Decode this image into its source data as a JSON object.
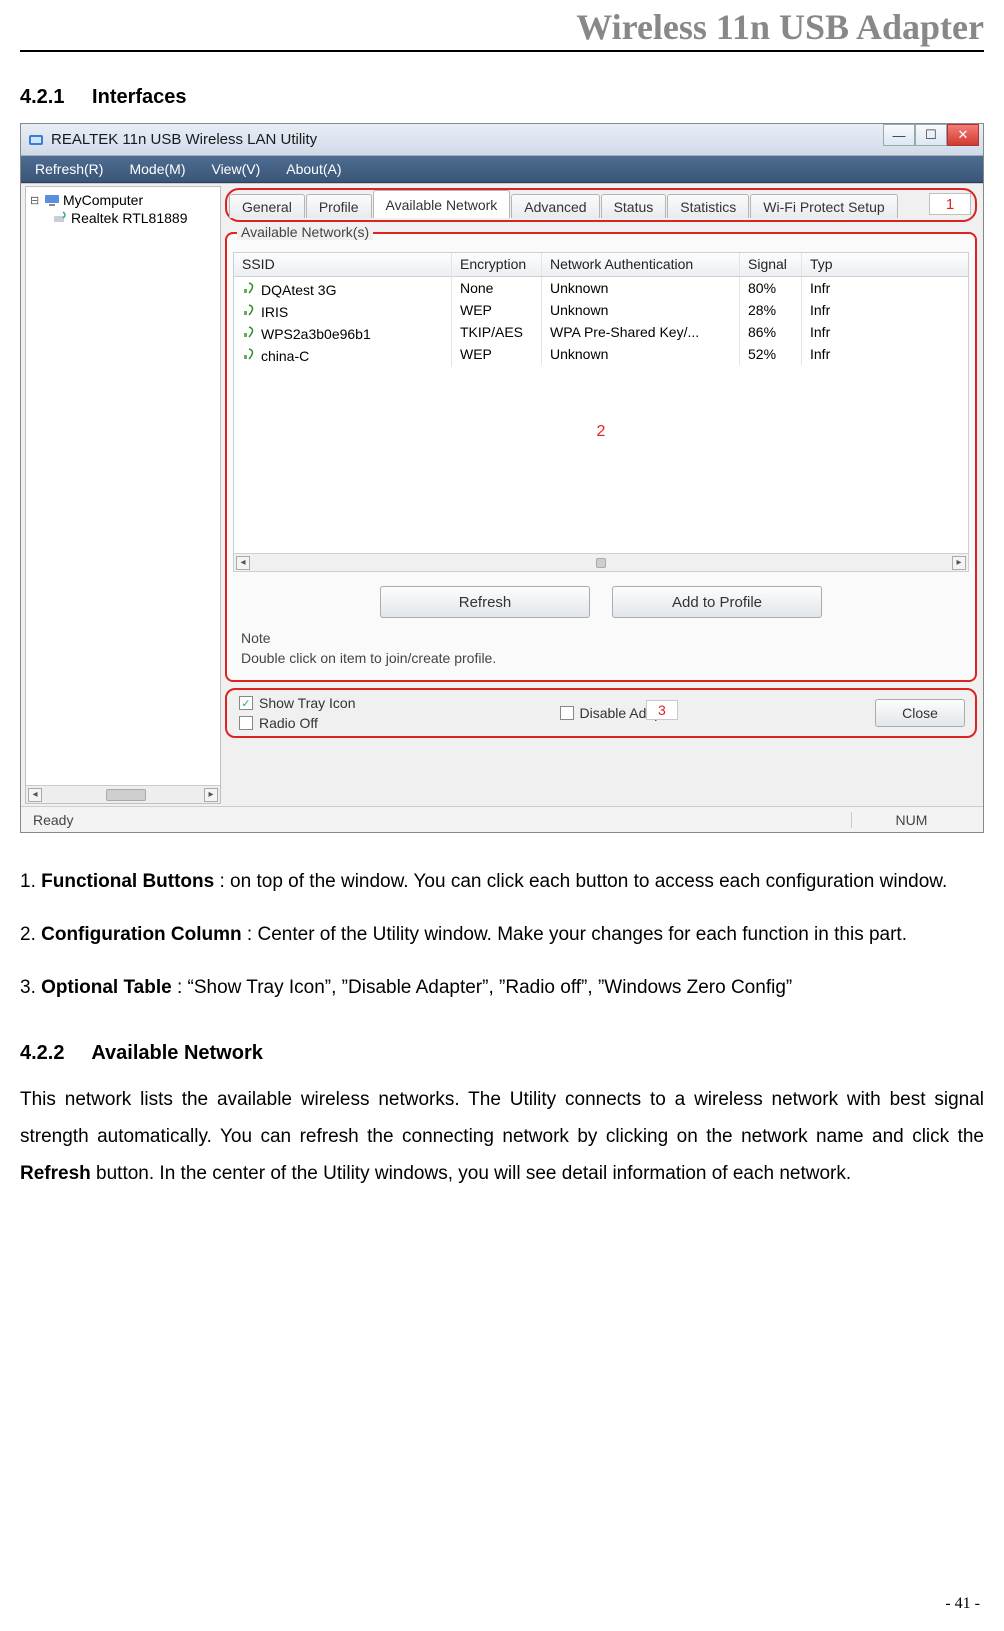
{
  "header": {
    "doc_title": "Wireless 11n USB Adapter"
  },
  "section421": {
    "number": "4.2.1",
    "title": "Interfaces"
  },
  "screenshot": {
    "titlebar": "REALTEK 11n USB Wireless LAN Utility",
    "menubar": [
      "Refresh(R)",
      "Mode(M)",
      "View(V)",
      "About(A)"
    ],
    "tree": {
      "root": "MyComputer",
      "child": "Realtek RTL81889"
    },
    "tabs": [
      "General",
      "Profile",
      "Available Network",
      "Advanced",
      "Status",
      "Statistics",
      "Wi-Fi Protect Setup"
    ],
    "active_tab_index": 2,
    "annotation_1": "1",
    "group_label": "Available Network(s)",
    "columns": [
      "SSID",
      "Encryption",
      "Network Authentication",
      "Signal",
      "Typ"
    ],
    "rows": [
      {
        "ssid": "DQAtest 3G",
        "enc": "None",
        "auth": "Unknown",
        "sig": "80%",
        "typ": "Infr"
      },
      {
        "ssid": "IRIS",
        "enc": "WEP",
        "auth": "Unknown",
        "sig": "28%",
        "typ": "Infr"
      },
      {
        "ssid": "WPS2a3b0e96b1",
        "enc": "TKIP/AES",
        "auth": "WPA Pre-Shared Key/...",
        "sig": "86%",
        "typ": "Infr"
      },
      {
        "ssid": "china-C",
        "enc": "WEP",
        "auth": "Unknown",
        "sig": "52%",
        "typ": "Infr"
      }
    ],
    "annotation_2": "2",
    "refresh_btn": "Refresh",
    "add_profile_btn": "Add to Profile",
    "note_label": "Note",
    "note_text": "Double click on item to join/create profile.",
    "options": {
      "show_tray": {
        "label": "Show Tray Icon",
        "checked": true
      },
      "radio_off": {
        "label": "Radio Off",
        "checked": false
      },
      "disable_adapter": {
        "label": "Disable Adapter",
        "checked": false
      }
    },
    "annotation_3": "3",
    "close_btn": "Close",
    "status_left": "Ready",
    "status_right": "NUM"
  },
  "list": {
    "item1_bold": "Functional Buttons",
    "item1_text": " : on top of the window. You can click each button to access each configuration window.",
    "item2_bold": "Configuration Column",
    "item2_text": " : Center of the Utility window. Make your changes for each function in this part.",
    "item3_bold": "Optional Table",
    "item3_text_a": " : “Show Tray Icon”, ”Disable Adapter”, ”Radio off”, ”Windows Zero Config”"
  },
  "section422": {
    "number": "4.2.2",
    "title": "Available Network",
    "para_a": "This network lists the available wireless networks. The Utility connects to a wireless network with best signal strength automatically. You can refresh the connecting network by clicking on the network name and click the ",
    "para_bold": "Refresh",
    "para_b": " button. In the center of the Utility windows, you will see detail information of each network."
  },
  "page_number": "- 41 -"
}
